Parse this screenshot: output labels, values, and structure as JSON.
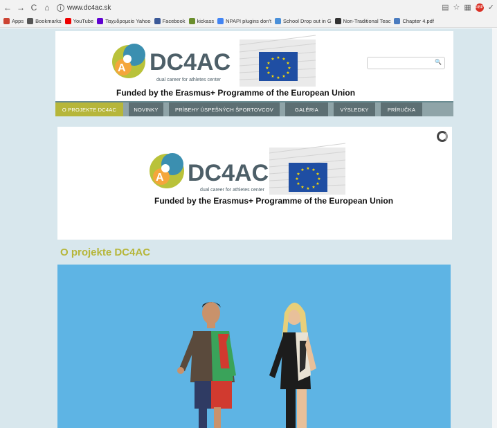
{
  "browser": {
    "back": "←",
    "forward": "→",
    "reload": "C",
    "home": "⌂",
    "url": "www.dc4ac.sk",
    "ext_badge": "ABP"
  },
  "bookmarks": [
    {
      "label": "Apps",
      "color": "#c43"
    },
    {
      "label": "Bookmarks",
      "color": "#555"
    },
    {
      "label": "YouTube",
      "color": "#e00"
    },
    {
      "label": "Ταχυδρομείο Yahoo",
      "color": "#5f01d1"
    },
    {
      "label": "Facebook",
      "color": "#3b5998"
    },
    {
      "label": "kickass",
      "color": "#6a8e2d"
    },
    {
      "label": "NPAPI plugins don't",
      "color": "#4285f4"
    },
    {
      "label": "School Drop out in G",
      "color": "#4a90d9"
    },
    {
      "label": "Non-Traditional Teac",
      "color": "#333"
    },
    {
      "label": "Chapter 4.pdf",
      "color": "#4a7bbf"
    }
  ],
  "header": {
    "logo_name": "DC4AC",
    "logo_tagline": "dual career for athletes center",
    "funded_text": "Funded by the Erasmus+ Programme of the European Union",
    "search_icon": "search-icon"
  },
  "menu": [
    {
      "label": "O PROJEKTE DC4AC",
      "active": true
    },
    {
      "label": "NOVINKY",
      "active": false
    },
    {
      "label": "PRÍBEHY ÚSPEŠNÝCH ŠPORTOVCOV",
      "active": false
    },
    {
      "label": "GALÉRIA",
      "active": false
    },
    {
      "label": "VÝSLEDKY",
      "active": false
    },
    {
      "label": "PRÍRUČKA",
      "active": false
    }
  ],
  "banner": {
    "logo_name": "DC4AC",
    "logo_tagline": "dual career for athletes center",
    "funded_text": "Funded by the Erasmus+ Programme of the European Union"
  },
  "section": {
    "title": "O projekte DC4AC"
  },
  "colors": {
    "accent": "#b6b63a",
    "page_bg": "#d8e7ed",
    "photo_bg": "#5eb4e4",
    "eu_blue": "#1f4ea3",
    "eu_star": "#ffdd00"
  }
}
